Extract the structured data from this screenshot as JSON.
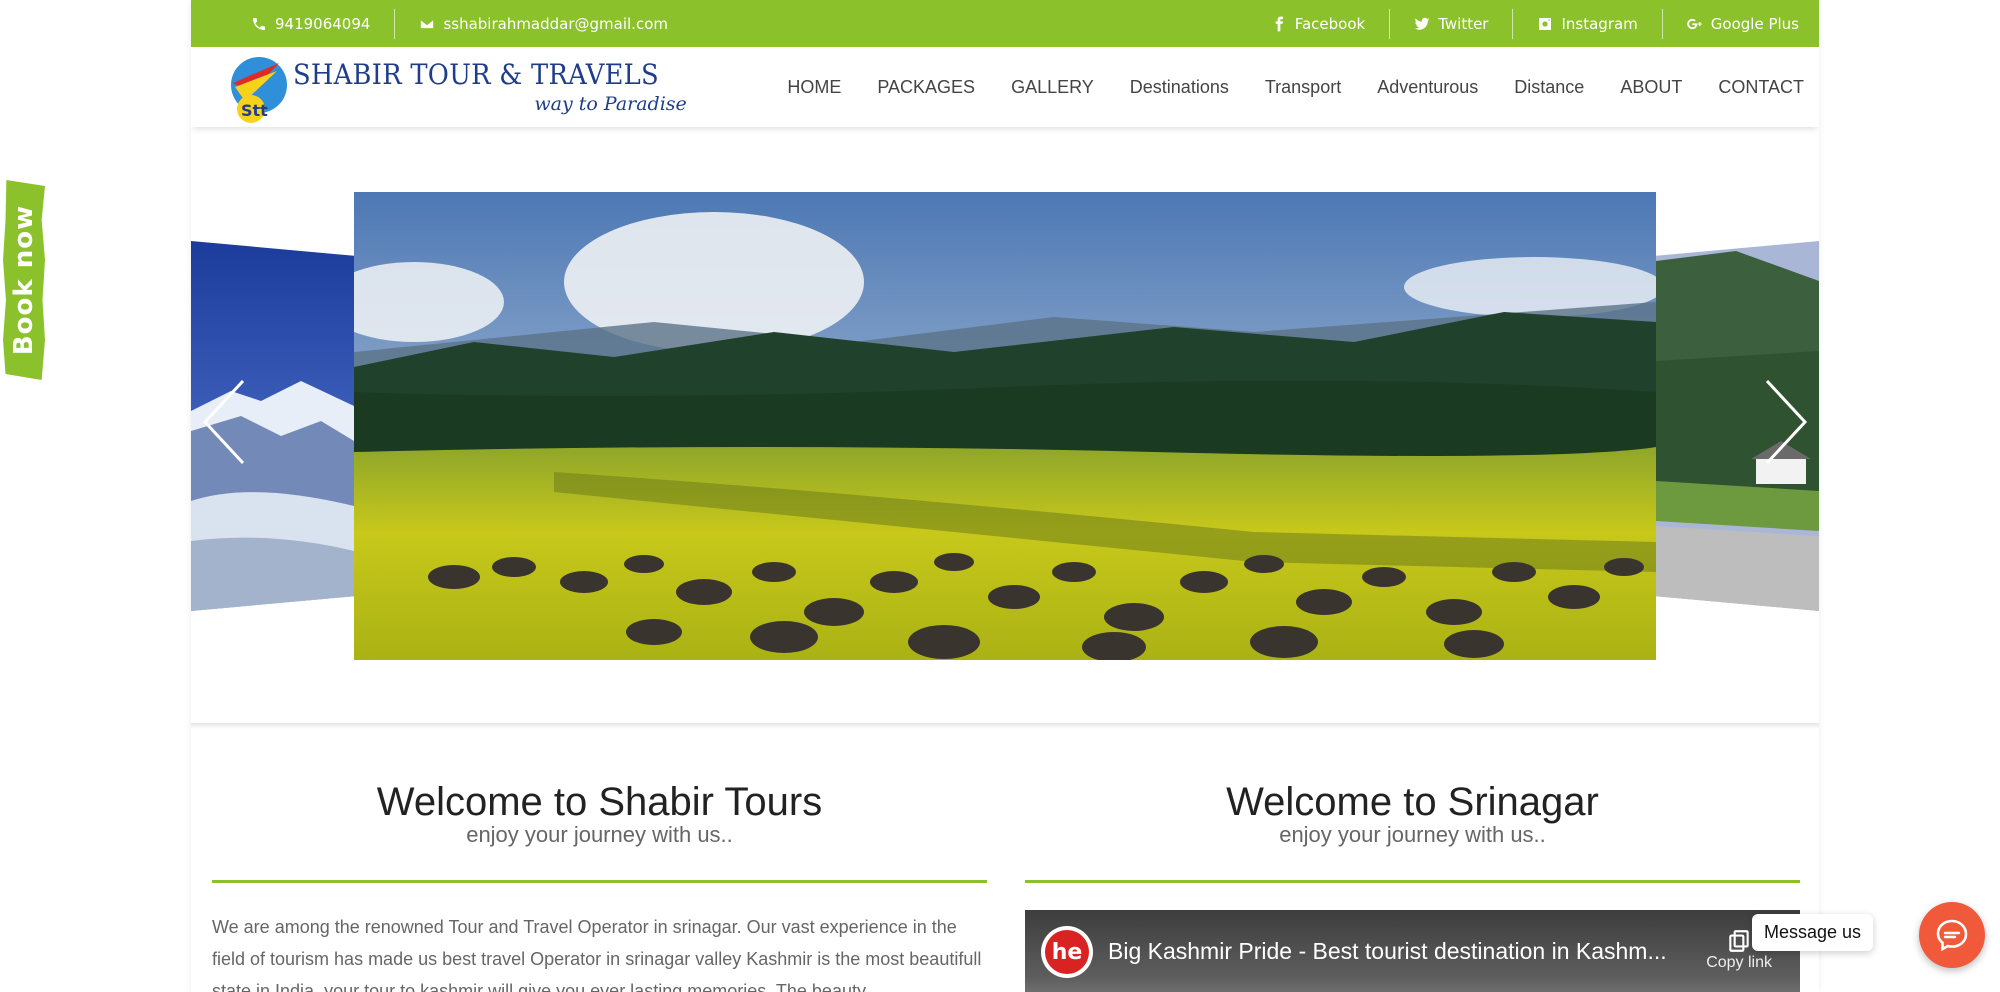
{
  "topbar": {
    "phone": "9419064094",
    "email": "sshabirahmaddar@gmail.com",
    "social": {
      "facebook": "Facebook",
      "twitter": "Twitter",
      "instagram": "Instagram",
      "google_plus": "Google Plus"
    }
  },
  "logo": {
    "mark_text": "Stt",
    "title": "SHABIR TOUR & TRAVELS",
    "tagline": "way to Paradise"
  },
  "nav": {
    "home": "HOME",
    "packages": "PACKAGES",
    "gallery": "GALLERY",
    "destinations": "Destinations",
    "transport": "Transport",
    "adventurous": "Adventurous",
    "distance": "Distance",
    "about": "ABOUT",
    "contact": "CONTACT"
  },
  "welcome_left": {
    "title": "Welcome to Shabir Tours",
    "subtitle": "enjoy your journey with us..",
    "body": "We are among the renowned Tour and Travel Operator in srinagar. Our vast experience in the field of tourism has made us best travel Operator in srinagar valley Kashmir is the most beautifull state in India, your tour to kashmir will give you ever lasting memories. The beauty"
  },
  "welcome_right": {
    "title": "Welcome to Srinagar",
    "subtitle": "enjoy your journey with us..",
    "video": {
      "channel_logo": "he",
      "title": "Big Kashmir Pride - Best tourist destination in Kashm...",
      "copy_label": "Copy link"
    }
  },
  "floating": {
    "book_now": "Book now",
    "message_us": "Message us"
  },
  "colors": {
    "accent": "#8bc22c",
    "brand_blue": "#1f3d8a",
    "message_button": "#f05a3b"
  }
}
